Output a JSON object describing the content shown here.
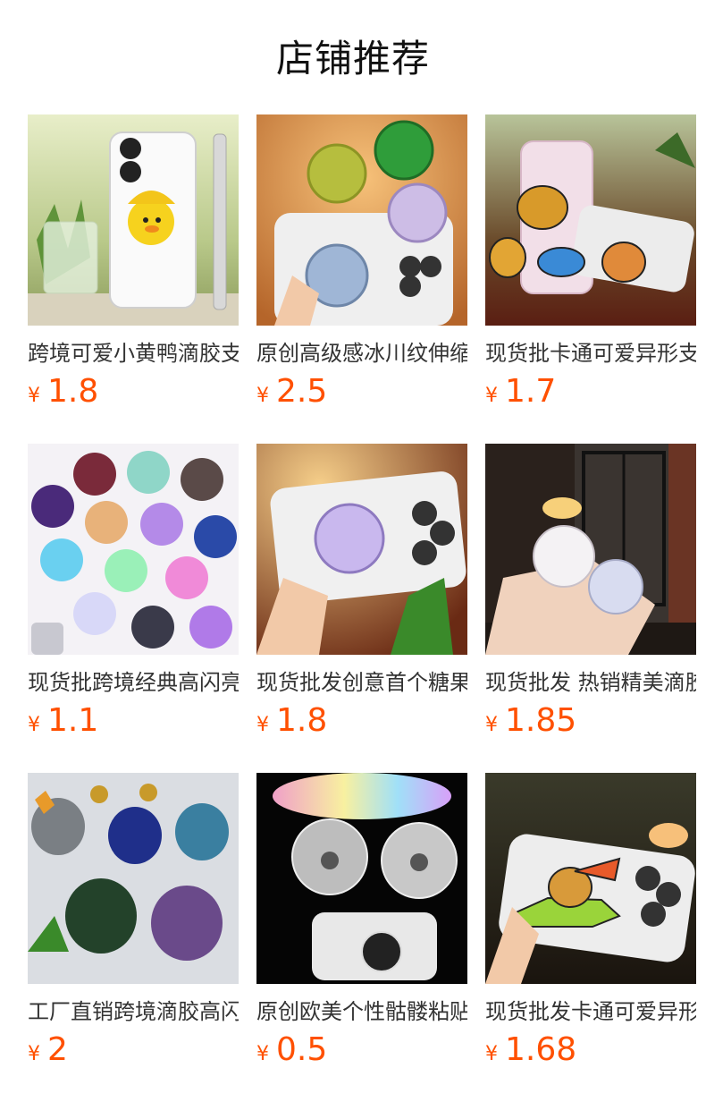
{
  "header": {
    "title": "店铺推荐"
  },
  "currency_symbol": "¥",
  "products": [
    {
      "name": "跨境可爱小黄鸭滴胶支架",
      "price": "1.8",
      "image": "yellow-duck-phone-case-image"
    },
    {
      "name": "原创高级感冰川纹伸缩支架",
      "price": "2.5",
      "image": "glacier-pattern-grip-image"
    },
    {
      "name": "现货批卡通可爱异形支架",
      "price": "1.7",
      "image": "cartoon-capybara-grip-image"
    },
    {
      "name": "现货批跨境经典高闪亮片支架",
      "price": "1.1",
      "image": "glitter-grips-collection-image"
    },
    {
      "name": "现货批发创意首个糖果支架",
      "price": "1.8",
      "image": "purple-glitter-grip-image"
    },
    {
      "name": "现货批发 热销精美滴胶支架",
      "price": "1.85",
      "image": "white-glitter-grip-image"
    },
    {
      "name": "工厂直销跨境滴胶高闪支架",
      "price": "2",
      "image": "sparkle-grips-set-image"
    },
    {
      "name": "原创欧美个性骷髅粘贴支架",
      "price": "0.5",
      "image": "skull-print-grip-image"
    },
    {
      "name": "现货批发卡通可爱异形支架",
      "price": "1.68",
      "image": "cartoon-crocodile-grip-image"
    }
  ]
}
